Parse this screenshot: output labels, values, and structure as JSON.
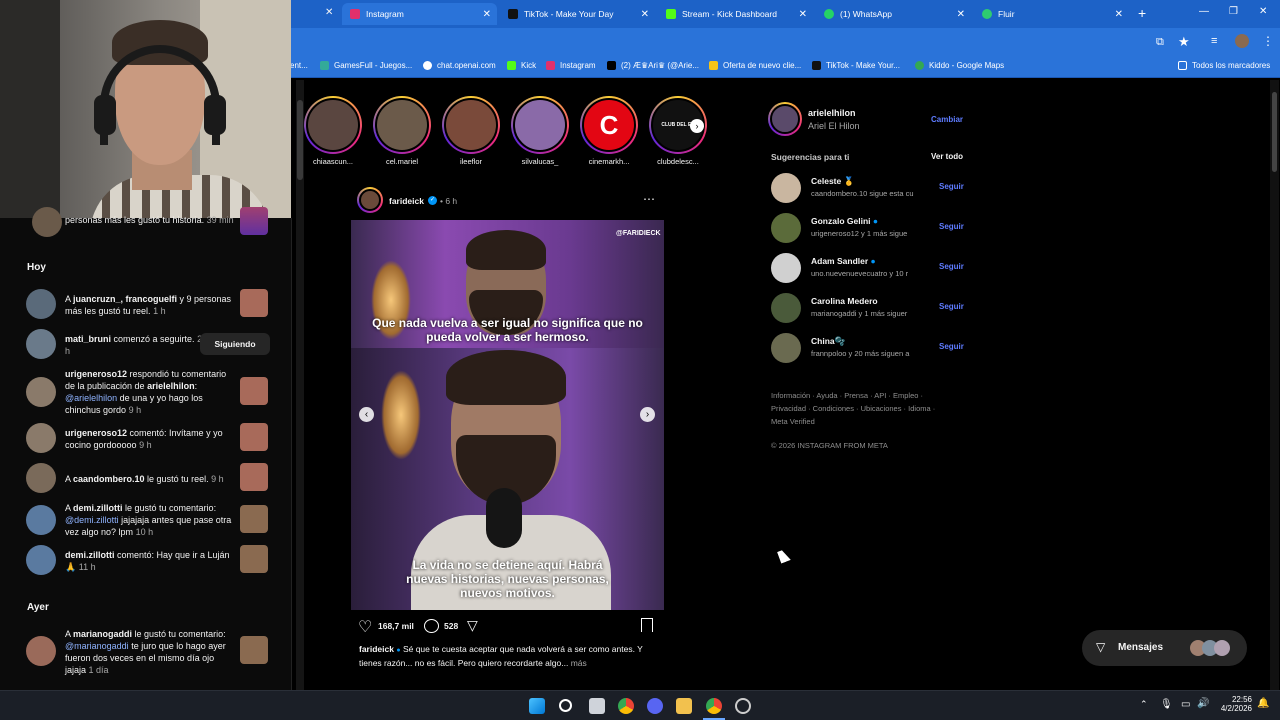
{
  "browser": {
    "tabs": [
      {
        "label": "Instagram",
        "active": true,
        "color": "#e1306c"
      },
      {
        "label": "TikTok - Make Your Day",
        "color": "#111111"
      },
      {
        "label": "Stream - Kick Dashboard",
        "color": "#53fc18"
      },
      {
        "label": "(1) WhatsApp",
        "color": "#25d366"
      },
      {
        "label": "Fluir",
        "color": "#2ecc71"
      }
    ],
    "new_tab": "+",
    "bookmarks": [
      "ent...",
      "GamesFull - Juegos...",
      "chat.openai.com",
      "Kick",
      "Instagram",
      "(2) Æ♛Ari♛ (@Arie...",
      "Oferta de nuevo clie...",
      "TikTok - Make Your...",
      "Kiddo - Google Maps"
    ],
    "all_bookmarks": "Todos los marcadores"
  },
  "notifications": {
    "top_partial": "personas más les gustó tu historia.",
    "top_partial_time": "39 min",
    "today_header": "Hoy",
    "yesterday_header": "Ayer",
    "items": [
      {
        "user": "juancruzn_, francoguelfi",
        "text": " y 9 personas más les gustó tu reel.",
        "time": "1 h",
        "prefix": "A "
      },
      {
        "user": "mati_bruni",
        "text": " comenzó a seguirte.",
        "time": "2 h",
        "prefix": "",
        "button": "Siguiendo"
      },
      {
        "user": "urigeneroso12",
        "text": " respondió tu comentario de la publicación de ",
        "user2": "arielelhilon",
        "mention": "@arielelhilon",
        "text2": " de una y yo hago los chinchus gordo",
        "time": "9 h",
        "prefix": ""
      },
      {
        "user": "urigeneroso12",
        "text": " comentó: Invítame y yo cocino gordooooo",
        "time": "9 h",
        "prefix": ""
      },
      {
        "user": "caandombero.10",
        "text": " le gustó tu reel.",
        "time": "9 h",
        "prefix": "A "
      },
      {
        "user": "demi.zillotti",
        "text": " le gustó tu comentario:",
        "mention": "@demi.zillotti",
        "text2": " jajajaja antes que pase otra vez algo no? lpm",
        "time": "10 h",
        "prefix": "A "
      },
      {
        "user": "demi.zillotti",
        "text": " comentó: Hay que ir a Luján 🙏",
        "time": "11 h",
        "prefix": ""
      },
      {
        "user": "marianogaddi",
        "text": " le gustó tu comentario:",
        "mention": "@marianogaddi",
        "text2": " te juro que lo hago ayer fueron dos veces en el mismo día ojo jajaja",
        "time": "1 día",
        "prefix": "A "
      }
    ]
  },
  "stories": [
    {
      "name": "chiaascun...",
      "color": "#5a4640"
    },
    {
      "name": "cel.mariel",
      "color": "#6b5a4a"
    },
    {
      "name": "ileeflor",
      "color": "#7a4a3a"
    },
    {
      "name": "silvalucas_",
      "color": "#8a6aa8"
    },
    {
      "name": "cinemarkh...",
      "color": "#e30613",
      "logo": "C"
    },
    {
      "name": "clubdelesc...",
      "color": "#111111",
      "logo": "CLUB DEL ES"
    }
  ],
  "post": {
    "author": "farideick",
    "time": "6 h",
    "watermark": "@FARIDIECK",
    "caption_top": "Que nada vuelva a ser igual no significa que no pueda volver a ser hermoso.",
    "caption_bottom": "La vida no se detiene aquí. Habrá nuevas historias, nuevas personas, nuevos motivos.",
    "likes": "168,7 mil",
    "comments": "528",
    "caption_user": "farideick",
    "caption_text": " Sé que te cuesta aceptar que nada volverá a ser como antes. Y tienes razón... no es fácil. Pero quiero recordarte algo...",
    "more": "más"
  },
  "profile": {
    "username": "arielelhilon",
    "fullname": "Ariel El Hilon",
    "switch": "Cambiar"
  },
  "suggestions": {
    "title": "Sugerencias para ti",
    "see_all": "Ver todo",
    "follow_label": "Seguir",
    "items": [
      {
        "name": "Celeste 🥇",
        "sub": "caandombero.10 sigue esta cu",
        "color": "#c9b6a0"
      },
      {
        "name": "Gonzalo Gelini",
        "sub": "urigeneroso12 y 1 más sigue",
        "color": "#5b6b3a",
        "verified": true
      },
      {
        "name": "Adam Sandler",
        "sub": "uno.nuevenuevecuatro y 10 r",
        "color": "#d0d0d0",
        "verified": true
      },
      {
        "name": "Carolina Medero",
        "sub": "marianogaddi y 1 más siguer",
        "color": "#4a5a3a"
      },
      {
        "name": "China🫧",
        "sub": "frannpoloo y 20 más siguen a",
        "color": "#6a6a50"
      }
    ],
    "footer1": "Información · Ayuda · Prensa · API · Empleo ·",
    "footer2": "Privacidad · Condiciones · Ubicaciones · Idioma ·",
    "footer3": "Meta Verified",
    "copyright": "© 2026 INSTAGRAM FROM META"
  },
  "messages": {
    "label": "Mensajes"
  },
  "taskbar": {
    "time": "22:56",
    "date": "4/2/2026"
  }
}
